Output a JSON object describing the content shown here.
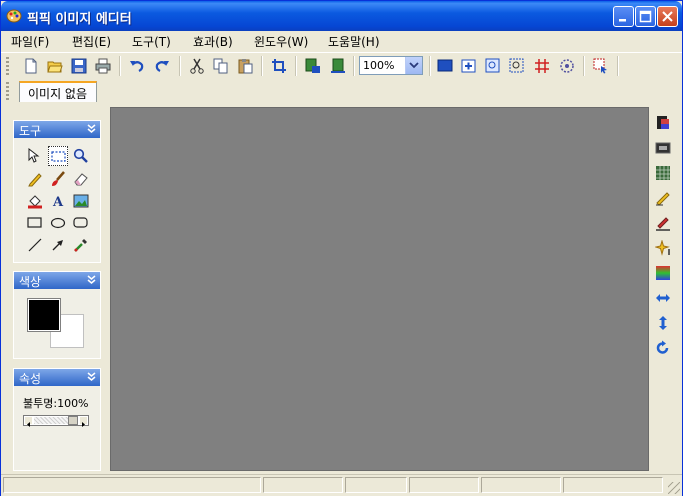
{
  "window": {
    "title": "픽픽 이미지 에디터"
  },
  "menu": [
    {
      "id": "file",
      "label": "파일(F)"
    },
    {
      "id": "edit",
      "label": "편집(E)"
    },
    {
      "id": "tools",
      "label": "도구(T)"
    },
    {
      "id": "effects",
      "label": "효과(B)"
    },
    {
      "id": "window",
      "label": "윈도우(W)"
    },
    {
      "id": "help",
      "label": "도움말(H)"
    }
  ],
  "toolbar": {
    "zoom_value": "100%",
    "icons": [
      "new-file-icon",
      "open-folder-icon",
      "save-icon",
      "print-icon",
      "undo-icon",
      "redo-icon",
      "cut-icon",
      "copy-icon",
      "paste-icon",
      "crop-icon",
      "image-size-icon",
      "canvas-size-icon",
      "fullscreen-icon",
      "zoom-in-icon",
      "zoom-fit-icon",
      "zoom-select-icon",
      "grid-icon",
      "zoom-circle-icon",
      "capture-icon"
    ]
  },
  "tabs": [
    {
      "label": "이미지 없음"
    }
  ],
  "panels": {
    "tools": {
      "title": "도구"
    },
    "color": {
      "title": "색상",
      "foreground": "#000000",
      "background": "#ffffff"
    },
    "properties": {
      "title": "속성",
      "opacity_label": "불투명:100%",
      "opacity_value": 100
    }
  },
  "right_toolbar": [
    "color-adjust-icon",
    "image-frame-icon",
    "mosaic-icon",
    "pencil-brush-icon",
    "highlight-pen-icon",
    "sparkle-icon",
    "gradient-icon",
    "flip-horizontal-icon",
    "flip-vertical-icon",
    "rotate-icon"
  ],
  "colors": {
    "titlebar": "#0a5fe8",
    "canvas": "#808080",
    "panel_header": "#2f66c8"
  }
}
